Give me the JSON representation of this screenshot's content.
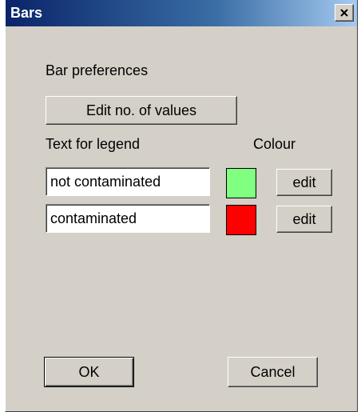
{
  "window": {
    "title": "Bars",
    "close_glyph": "✕"
  },
  "section": {
    "heading": "Bar preferences",
    "edit_values_label": "Edit no. of values"
  },
  "legend": {
    "text_header": "Text for legend",
    "colour_header": "Colour",
    "rows": [
      {
        "text": "not contaminated",
        "color": "#80ff80",
        "edit_label": "edit"
      },
      {
        "text": "contaminated",
        "color": "#ff0000",
        "edit_label": "edit"
      }
    ]
  },
  "footer": {
    "ok_label": "OK",
    "cancel_label": "Cancel"
  }
}
